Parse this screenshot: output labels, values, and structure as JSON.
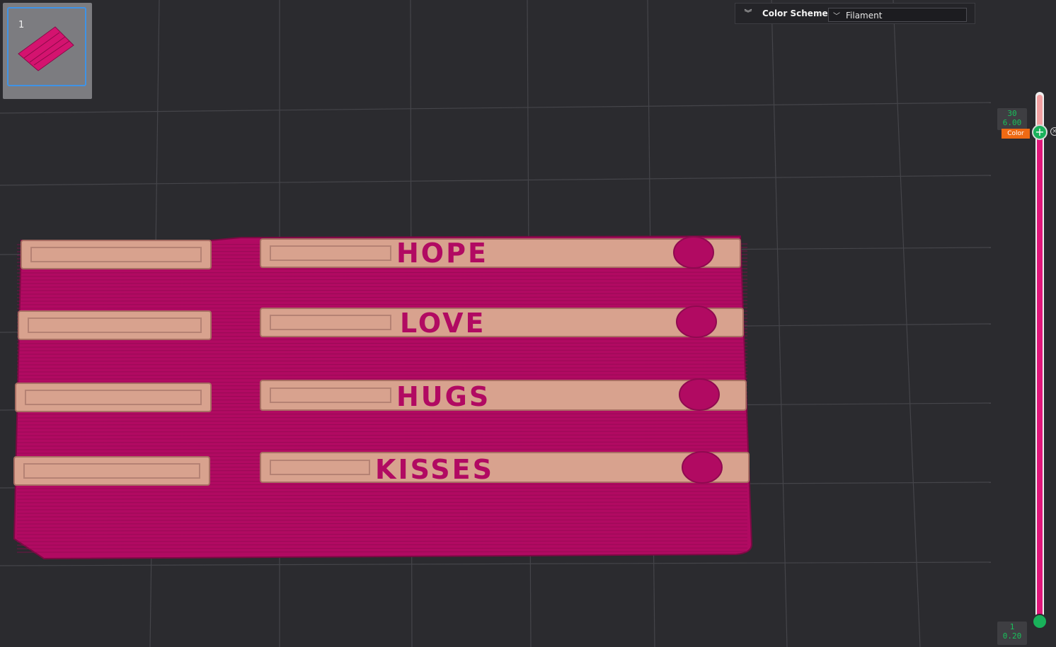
{
  "colors": {
    "background": "#2b2b2f",
    "grid": "#45454a",
    "model_body": "#b10a62",
    "model_body_dark": "#8f0a50",
    "model_top": "#d8a28e",
    "slider_fill": "#e0167a",
    "slider_top": "#f2a0a2",
    "handle": "#19b15a",
    "label_text": "#19c05b",
    "color_tag": "#ef6a13",
    "thumb_border": "#3f93e6"
  },
  "plate_thumbnail": {
    "number": "1"
  },
  "color_scheme": {
    "title": "Color Scheme",
    "selected": "Filament",
    "collapse_icon": "double-chevron-down-icon",
    "dropdown_icon": "chevron-down-icon"
  },
  "layer_slider": {
    "top_layer": "30",
    "top_height": "6.00",
    "bottom_layer": "1",
    "bottom_height": "0.20",
    "color_tag": "Color",
    "add_icon": "plus-icon",
    "delete_icon": "close-icon"
  },
  "model": {
    "words": [
      "HOPE",
      "LOVE",
      "HUGS",
      "KISSES"
    ]
  }
}
